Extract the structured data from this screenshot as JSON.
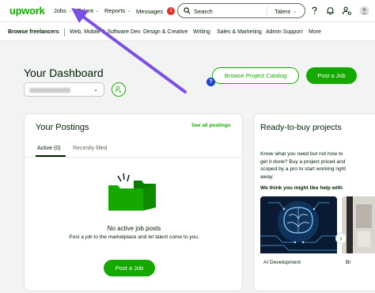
{
  "nav": {
    "logo": "upwork",
    "jobs": "Jobs",
    "talent": "Talent",
    "reports": "Reports",
    "messages": "Messages",
    "messages_count": "2",
    "search_placeholder": "Search",
    "search_scope": "Talent"
  },
  "subnav": {
    "items": [
      "Browse freelancers",
      "Web, Mobile & Software Dev",
      "Design & Creative",
      "Writing",
      "Sales & Marketing",
      "Admin Support",
      "More"
    ]
  },
  "dashboard": {
    "title": "Your Dashboard",
    "browse_catalog": "Browse Project Catalog",
    "post_job": "Post a Job",
    "help": "?"
  },
  "postings": {
    "title": "Your Postings",
    "see_all": "See all postings",
    "tabs": [
      {
        "label": "Active (0)",
        "active": true
      },
      {
        "label": "Recently filled",
        "active": false
      }
    ],
    "empty_title": "No active job posts",
    "empty_subtitle": "Post a job to the marketplace and let talent come to you.",
    "post_job": "Post a Job"
  },
  "ready": {
    "title": "Ready-to-buy projects",
    "description": "Know what you need but not how to get it done? Buy a project priced and scoped by a pro to start working right away.",
    "suggest": "We think you might like help with",
    "projects": [
      {
        "label": "AI Development"
      },
      {
        "label": "Br"
      }
    ]
  },
  "colors": {
    "brand_green": "#14a800",
    "text": "#001e00",
    "badge_red": "#d93025",
    "annotation_arrow": "#7b4fe0"
  }
}
